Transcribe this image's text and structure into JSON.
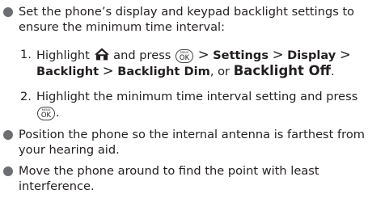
{
  "colors": {
    "text": "#231f20",
    "bullet": "#6d6e71"
  },
  "icons": {
    "home": "home-icon",
    "menu_ok": "menu-ok-key-icon"
  },
  "bullet1": {
    "line1": "Set the phone’s display and keypad backlight settings to",
    "line2": "ensure the minimum time interval:"
  },
  "step1": {
    "number": "1.",
    "pre": "Highlight",
    "mid": "and press",
    "sep1": ">",
    "settings": "Settings",
    "sep2": ">",
    "display": "Display",
    "sep3": ">",
    "backlight": "Backlight",
    "sep4": ">",
    "backlight_dim": "Backlight Dim",
    "or": ", or",
    "backlight_off": "Backlight Off",
    "end": "."
  },
  "step2": {
    "number": "2.",
    "line1": "Highlight the minimum time interval setting and press",
    "end": "."
  },
  "ok_key": {
    "top": "MENU",
    "label": "OK"
  },
  "bullet2": {
    "line1": "Position the phone so the internal antenna is farthest from",
    "line2": "your hearing aid."
  },
  "bullet3": {
    "line1": "Move the phone around to find the point with least",
    "line2": "interference."
  }
}
